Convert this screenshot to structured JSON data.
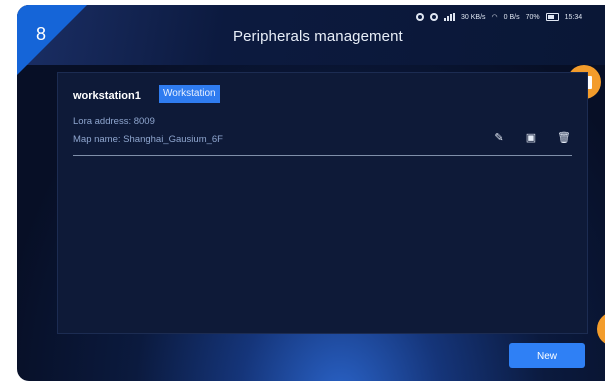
{
  "step_number": "8",
  "header": {
    "title": "Peripherals management"
  },
  "status_bar": {
    "net_speed_1": "30 KB/s",
    "net_speed_2": "0 B/s",
    "battery": "70%",
    "time": "15:34"
  },
  "workstation": {
    "name": "workstation1",
    "tag": "Workstation",
    "lora_address": "Lora address: 8009",
    "map_name": "Map name: Shanghai_Gausium_6F"
  },
  "actions": {
    "new_label": "New"
  },
  "icons": [
    "edit-icon",
    "export-icon",
    "delete-icon",
    "book-icon"
  ],
  "colors": {
    "accent": "#2f7cf0",
    "orange": "#f39c2b",
    "background": "#0b1a3e"
  }
}
